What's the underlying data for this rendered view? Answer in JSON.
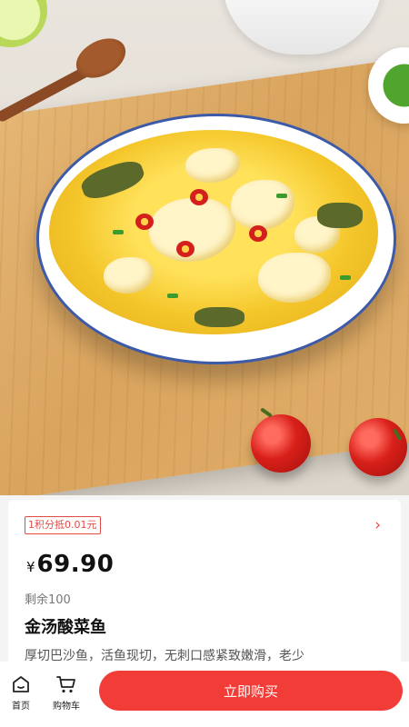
{
  "product": {
    "coupon_tag": "1积分抵0.01元",
    "price_symbol": "¥",
    "price": "69.90",
    "stock_text": "剩余100",
    "title": "金汤酸菜鱼",
    "description": "厚切巴沙鱼，活鱼现切，无刺口感紧致嫩滑，老少"
  },
  "bottom_nav": {
    "home_label": "首页",
    "cart_label": "购物车",
    "buy_label": "立即购买"
  },
  "colors": {
    "accent": "#f23c37",
    "coupon": "#e24b45"
  },
  "icons": {
    "home": "home-icon",
    "cart": "cart-icon",
    "chevron": "chevron-right-icon"
  }
}
